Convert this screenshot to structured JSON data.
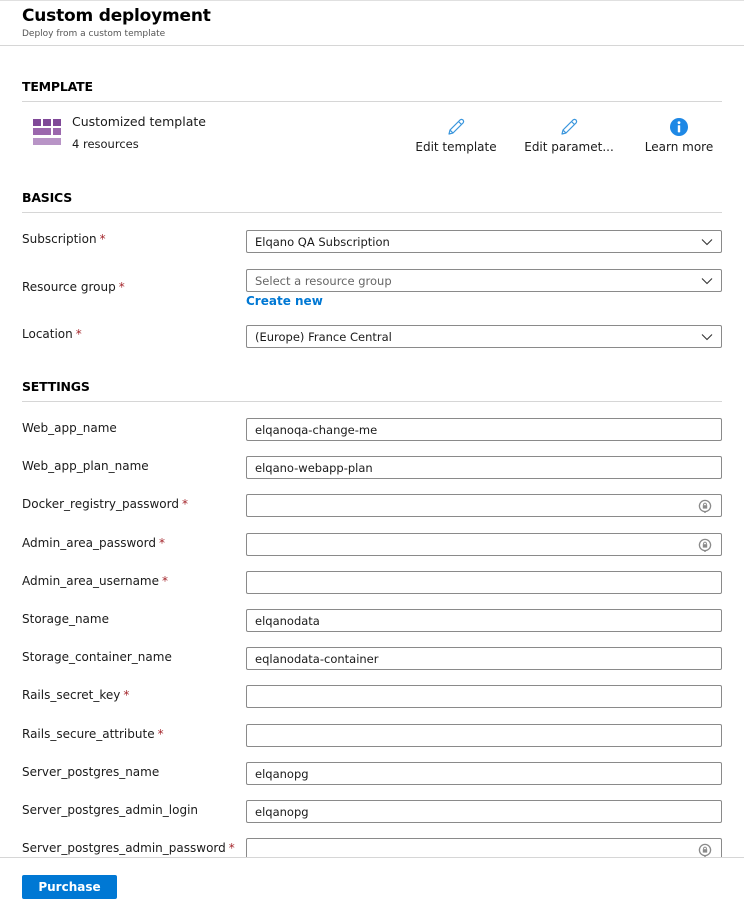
{
  "header": {
    "title": "Custom deployment",
    "subtitle": "Deploy from a custom template"
  },
  "template": {
    "section_title": "TEMPLATE",
    "icon": "template-grid-icon",
    "name": "Customized template",
    "resource_count": "4 resources",
    "actions": [
      {
        "label": "Edit template",
        "icon": "pencil-icon"
      },
      {
        "label": "Edit paramet...",
        "icon": "pencil-icon"
      },
      {
        "label": "Learn more",
        "icon": "info-icon"
      }
    ]
  },
  "basics": {
    "section_title": "BASICS",
    "subscription": {
      "label": "Subscription",
      "required": "*",
      "value": "Elqano QA Subscription"
    },
    "resource_group": {
      "label": "Resource group",
      "required": "*",
      "value": "",
      "placeholder": "Select a resource group",
      "create_new": "Create new"
    },
    "location": {
      "label": "Location",
      "required": "*",
      "value": "(Europe) France Central"
    }
  },
  "settings": {
    "section_title": "SETTINGS",
    "fields": [
      {
        "label": "Web_app_name",
        "required": "",
        "value": "elqanoqa-change-me",
        "secure": false
      },
      {
        "label": "Web_app_plan_name",
        "required": "",
        "value": "elqano-webapp-plan",
        "secure": false
      },
      {
        "label": "Docker_registry_password",
        "required": "*",
        "value": "",
        "secure": true
      },
      {
        "label": "Admin_area_password",
        "required": "*",
        "value": "",
        "secure": true
      },
      {
        "label": "Admin_area_username",
        "required": "*",
        "value": "",
        "secure": false
      },
      {
        "label": "Storage_name",
        "required": "",
        "value": "elqanodata",
        "secure": false
      },
      {
        "label": "Storage_container_name",
        "required": "",
        "value": "eqlanodata-container",
        "secure": false
      },
      {
        "label": "Rails_secret_key",
        "required": "*",
        "value": "",
        "secure": false
      },
      {
        "label": "Rails_secure_attribute",
        "required": "*",
        "value": "",
        "secure": false
      },
      {
        "label": "Server_postgres_name",
        "required": "",
        "value": "elqanopg",
        "secure": false
      },
      {
        "label": "Server_postgres_admin_login",
        "required": "",
        "value": "elqanopg",
        "secure": false
      },
      {
        "label": "Server_postgres_admin_password",
        "required": "*",
        "value": "",
        "secure": true
      }
    ]
  },
  "footer": {
    "purchase_label": "Purchase"
  },
  "colors": {
    "accent": "#0078d4",
    "required": "#a4262c",
    "template_icon": "#804998"
  }
}
